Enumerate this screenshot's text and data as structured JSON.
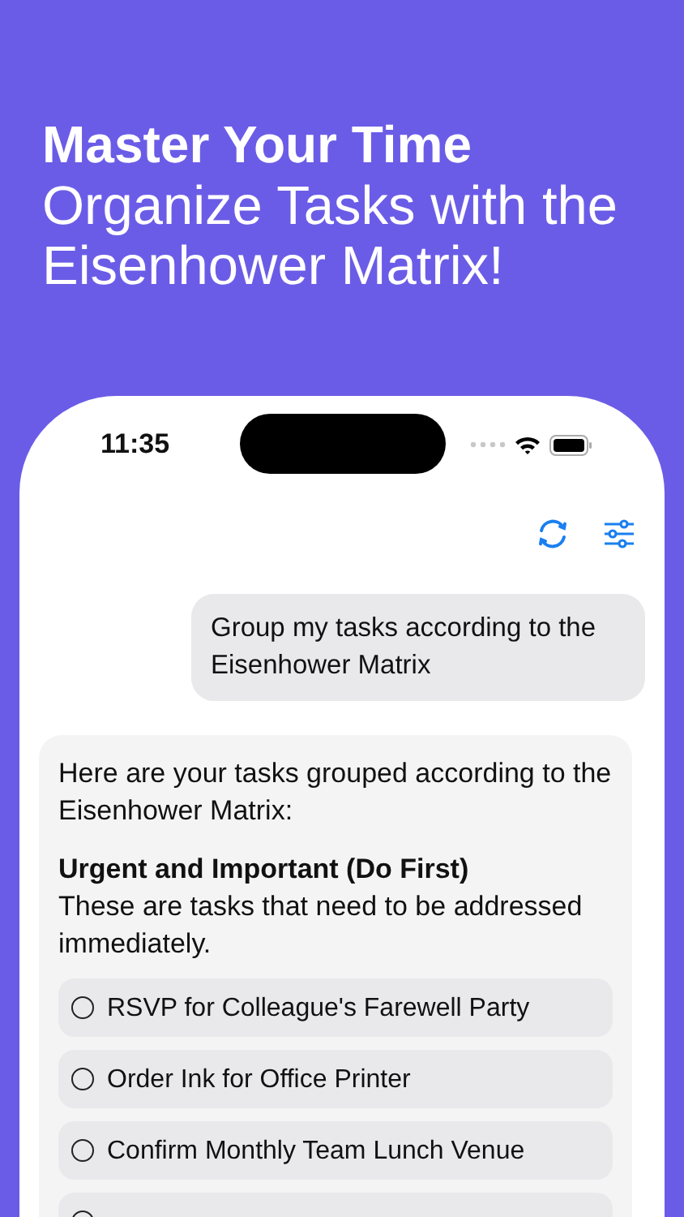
{
  "headline": {
    "title": "Master Your Time",
    "subtitle": "Organize Tasks with the Eisenhower Matrix!"
  },
  "status_bar": {
    "time": "11:35"
  },
  "chat": {
    "user_message": "Group my tasks according to the Eisenhower Matrix",
    "reply": {
      "intro": "Here are your tasks grouped according to the Eisenhower Matrix:",
      "section_title": "Urgent and Important (Do First)",
      "section_text": "These are tasks that need to be addressed immediately.",
      "tasks": [
        {
          "label": "RSVP for Colleague's Farewell Party",
          "checked": false
        },
        {
          "label": "Order Ink for Office Printer",
          "checked": false
        },
        {
          "label": "Confirm Monthly Team Lunch Venue",
          "checked": false
        },
        {
          "checked": false
        }
      ]
    }
  }
}
